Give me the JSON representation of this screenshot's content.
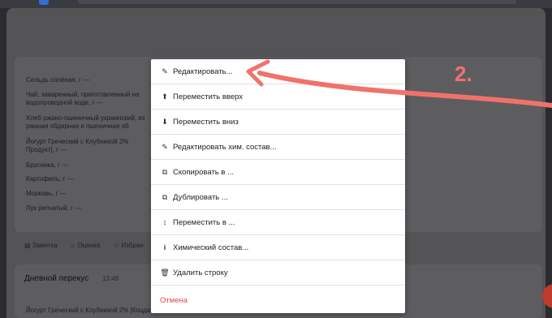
{
  "foods_visible": [
    {
      "name": "Сельдь солёная, г ---"
    },
    {
      "name": "Чай, заваренный, приготовленный на\nводопроводной воде, г ---"
    },
    {
      "name": "Хлеб ржано-пшеничный украинский, из\nржаная обдирная и пшеничная об"
    },
    {
      "name": "Йогурт Греческий с Клубникой 2%\nПродукт], г ---"
    },
    {
      "name": "Брусника, г ---"
    },
    {
      "name": "Картофель, г ---"
    },
    {
      "name": "Морковь, г ---"
    },
    {
      "name": "Лук репчатый, г ---"
    }
  ],
  "footer": {
    "note": "Заметка",
    "rating": "Оценка",
    "favorite": "Избран"
  },
  "meal2": {
    "title": "Дневной перекус",
    "time": "13:48",
    "first_item": "Йогурт Греческий с Клубникой 2% [Коцдия]"
  },
  "menu": {
    "items": [
      {
        "label": "Редактировать...",
        "icon": "edit-icon",
        "glyph": "✎"
      },
      {
        "label": "Переместить вверх",
        "icon": "arrow-up-circle-icon",
        "glyph": "⬆"
      },
      {
        "label": "Переместить вниз",
        "icon": "arrow-down-circle-icon",
        "glyph": "⬇"
      },
      {
        "label": "Редактировать хим. состав...",
        "icon": "edit-icon",
        "glyph": "✎"
      },
      {
        "label": "Скопировать в ...",
        "icon": "copy-icon",
        "glyph": "⧉"
      },
      {
        "label": "Дублировать ...",
        "icon": "duplicate-icon",
        "glyph": "⧉"
      },
      {
        "label": "Переместить в ...",
        "icon": "move-vertical-icon",
        "glyph": "↕"
      },
      {
        "label": "Химический состав...",
        "icon": "info-icon",
        "glyph": "i"
      },
      {
        "label": "Удалить строку",
        "icon": "trash-icon",
        "glyph": "🗑"
      }
    ],
    "cancel": "Отмена"
  },
  "annotation": {
    "number": "2."
  },
  "colors": {
    "cancel": "#e0464d",
    "annotation": "#f0726a",
    "menu_bg": "#ffffff",
    "overlay": "#545457"
  }
}
